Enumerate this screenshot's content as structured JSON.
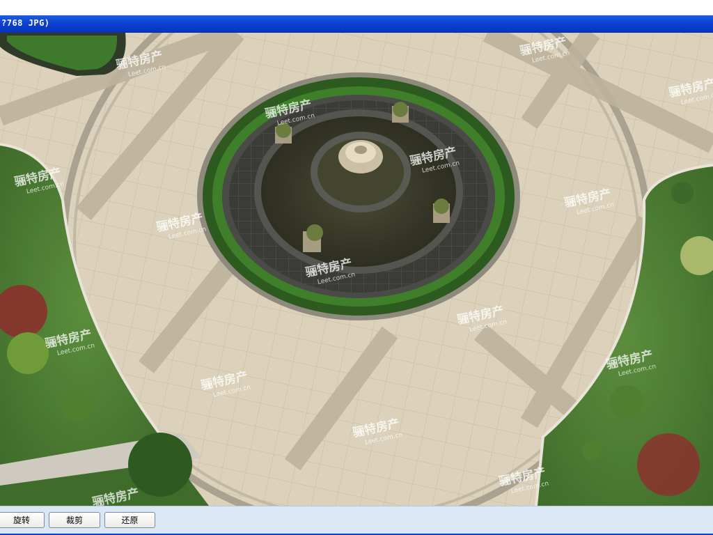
{
  "window": {
    "title": "?768 JPG)"
  },
  "toolbar": {
    "rotate_label": "旋转",
    "crop_label": "裁剪",
    "restore_label": "还原"
  },
  "watermark": {
    "brand": "骊特房产",
    "url": "Leet.com.cn"
  },
  "icons": {
    "watermark_logo": "house-logo-icon"
  },
  "colors": {
    "titlebar_blue": "#0a3fd0",
    "toolbar_bg": "#dbe7f5",
    "plaza_paving": "#d8cdb6",
    "lawn_green": "#4f7f36",
    "hedge_green": "#3d7a2a",
    "pool_water": "#3a3a2a"
  }
}
